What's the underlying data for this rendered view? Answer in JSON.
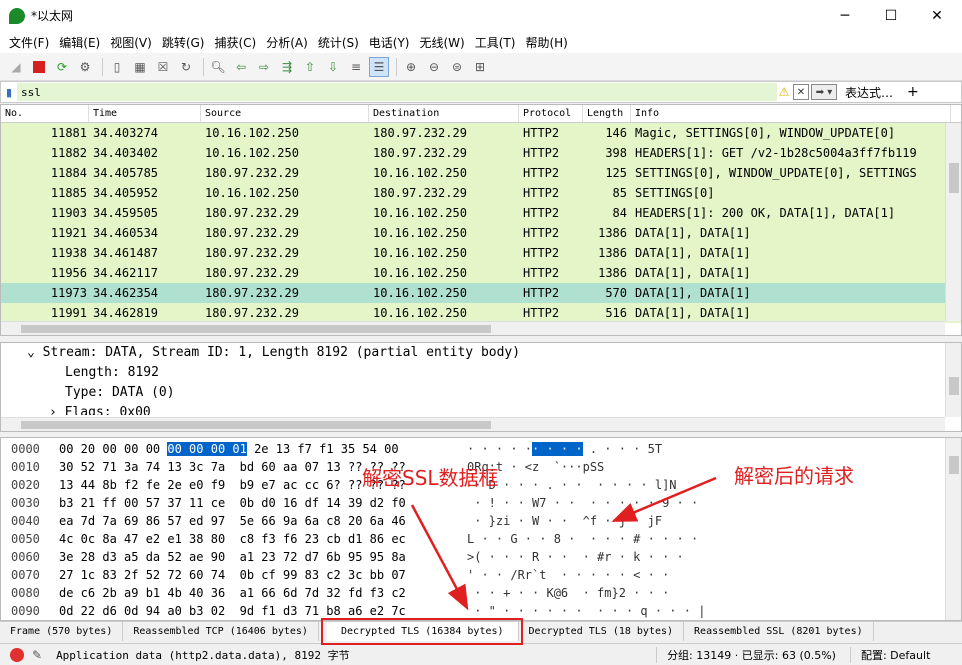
{
  "window": {
    "title": "*以太网",
    "minimize_icon": "─",
    "maximize_icon": "☐",
    "close_icon": "✕"
  },
  "menu": [
    "文件(F)",
    "编辑(E)",
    "视图(V)",
    "跳转(G)",
    "捕获(C)",
    "分析(A)",
    "统计(S)",
    "电话(Y)",
    "无线(W)",
    "工具(T)",
    "帮助(H)"
  ],
  "filter": {
    "value": "ssl",
    "expression_label": "表达式…",
    "add_label": "+"
  },
  "packet_list": {
    "columns": [
      "No.",
      "Time",
      "Source",
      "Destination",
      "Protocol",
      "Length",
      "Info"
    ],
    "rows": [
      [
        "11881",
        "34.403274",
        "10.16.102.250",
        "180.97.232.29",
        "HTTP2",
        "146",
        "Magic, SETTINGS[0], WINDOW_UPDATE[0]"
      ],
      [
        "11882",
        "34.403402",
        "10.16.102.250",
        "180.97.232.29",
        "HTTP2",
        "398",
        "HEADERS[1]: GET /v2-1b28c5004a3ff7fb119"
      ],
      [
        "11884",
        "34.405785",
        "180.97.232.29",
        "10.16.102.250",
        "HTTP2",
        "125",
        "SETTINGS[0], WINDOW_UPDATE[0], SETTINGS"
      ],
      [
        "11885",
        "34.405952",
        "10.16.102.250",
        "180.97.232.29",
        "HTTP2",
        "85",
        "SETTINGS[0]"
      ],
      [
        "11903",
        "34.459505",
        "180.97.232.29",
        "10.16.102.250",
        "HTTP2",
        "84",
        "HEADERS[1]: 200 OK, DATA[1], DATA[1]"
      ],
      [
        "11921",
        "34.460534",
        "180.97.232.29",
        "10.16.102.250",
        "HTTP2",
        "1386",
        "DATA[1], DATA[1]"
      ],
      [
        "11938",
        "34.461487",
        "180.97.232.29",
        "10.16.102.250",
        "HTTP2",
        "1386",
        "DATA[1], DATA[1]"
      ],
      [
        "11956",
        "34.462117",
        "180.97.232.29",
        "10.16.102.250",
        "HTTP2",
        "1386",
        "DATA[1], DATA[1]"
      ],
      [
        "11973",
        "34.462354",
        "180.97.232.29",
        "10.16.102.250",
        "HTTP2",
        "570",
        "DATA[1], DATA[1]"
      ],
      [
        "11991",
        "34.462819",
        "180.97.232.29",
        "10.16.102.250",
        "HTTP2",
        "516",
        "DATA[1], DATA[1]"
      ]
    ],
    "selected_row": 8
  },
  "details": {
    "lines": [
      "Stream: DATA, Stream ID: 1, Length 8192 (partial entity body)",
      "Length: 8192",
      "Type: DATA (0)",
      "Flags: 0x00"
    ]
  },
  "hex": {
    "rows": [
      {
        "off": "0000",
        "pre": "00 20 00 00 00 ",
        "hl": "00 00 00 01",
        "post": " 2e 13 f7 f1 35 54 00",
        "apre": "· · · · ·",
        "ahl": "· · · ·",
        "apost": " . · · · 5T"
      },
      {
        "off": "0010",
        "pre": "30 52 71 3a 74 13 3c 7a  bd 60 aa 07 13 ?? ?? ??",
        "hl": "",
        "post": "",
        "apre": "0Rq:t · <z  `···pSS",
        "ahl": "",
        "apost": ""
      },
      {
        "off": "0020",
        "pre": "13 44 8b f2 fe 2e e0 f9  b9 e7 ac cc 6? ?? ?? ??",
        "hl": "",
        "post": "",
        "apre": " · D · · · . · ·  · · · · l]N",
        "ahl": "",
        "apost": ""
      },
      {
        "off": "0030",
        "pre": "b3 21 ff 00 57 37 11 ce  0b d0 16 df 14 39 d2 f0",
        "hl": "",
        "post": "",
        "apre": " · ! · · W7 · ·  · · · · · 9 · ·",
        "ahl": "",
        "apost": ""
      },
      {
        "off": "0040",
        "pre": "ea 7d 7a 69 86 57 ed 97  5e 66 9a 6a c8 20 6a 46",
        "hl": "",
        "post": "",
        "apre": " · }zi · W · ·  ^f · j · jF",
        "ahl": "",
        "apost": ""
      },
      {
        "off": "0050",
        "pre": "4c 0c 8a 47 e2 e1 38 80  c8 f3 f6 23 cb d1 86 ec",
        "hl": "",
        "post": "",
        "apre": "L · · G · · 8 ·  · · · # · · · ·",
        "ahl": "",
        "apost": ""
      },
      {
        "off": "0060",
        "pre": "3e 28 d3 a5 da 52 ae 90  a1 23 72 d7 6b 95 95 8a",
        "hl": "",
        "post": "",
        "apre": ">( · · · R · ·  · #r · k · · ·",
        "ahl": "",
        "apost": ""
      },
      {
        "off": "0070",
        "pre": "27 1c 83 2f 52 72 60 74  0b cf 99 83 c2 3c bb 07",
        "hl": "",
        "post": "",
        "apre": "' · · /Rr`t  · · · · · < · ·",
        "ahl": "",
        "apost": ""
      },
      {
        "off": "0080",
        "pre": "de c6 2b a9 b1 4b 40 36  a1 66 6d 7d 32 fd f3 c2",
        "hl": "",
        "post": "",
        "apre": " · · + · · K@6  · fm}2 · · ·",
        "ahl": "",
        "apost": ""
      },
      {
        "off": "0090",
        "pre": "0d 22 d6 0d 94 a0 b3 02  9d f1 d3 71 b8 a6 e2 7c",
        "hl": "",
        "post": "",
        "apre": " · \" · · · · · ·  · · · q · · · |",
        "ahl": "",
        "apost": ""
      }
    ]
  },
  "bottom_tabs": [
    "Frame (570 bytes)",
    "Reassembled TCP (16406 bytes)",
    "Decrypted TLS (16384 bytes)",
    "Decrypted TLS (18 bytes)",
    "Reassembled SSL (8201 bytes)"
  ],
  "status": {
    "message": "Application data (http2.data.data), 8192 字节",
    "packets": "分组: 13149 · 已显示: 63 (0.5%)",
    "profile": "配置: Default"
  },
  "annotations": {
    "box_label": "解密SSL数据框",
    "request_label": "解密后的请求"
  },
  "colors": {
    "row_bg": "#e4f5c8",
    "row_selected": "#b0e0d0",
    "highlight": "#0064c8",
    "annotation": "#e02020",
    "filter_bg": "#e4f5d4"
  }
}
